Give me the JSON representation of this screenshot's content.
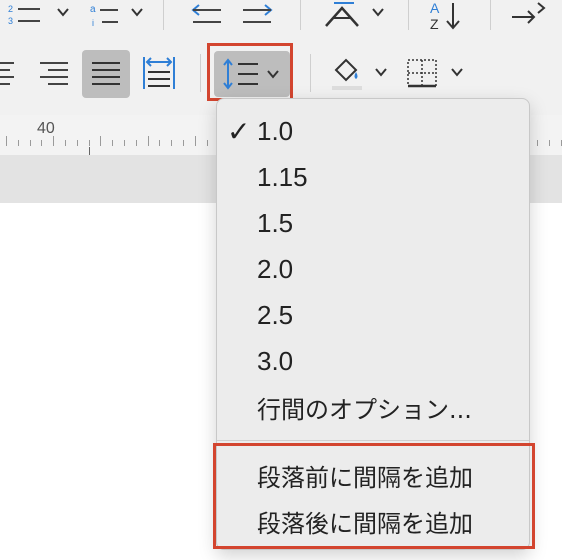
{
  "ruler": {
    "number": "40"
  },
  "line_spacing_menu": {
    "selected": "1.0",
    "items": [
      {
        "label": "1.0",
        "checked": true
      },
      {
        "label": "1.15",
        "checked": false
      },
      {
        "label": "1.5",
        "checked": false
      },
      {
        "label": "2.0",
        "checked": false
      },
      {
        "label": "2.5",
        "checked": false
      },
      {
        "label": "3.0",
        "checked": false
      },
      {
        "label": "行間のオプション...",
        "checked": false
      }
    ],
    "paragraph_items": [
      {
        "label": "段落前に間隔を追加"
      },
      {
        "label": "段落後に間隔を追加"
      }
    ]
  },
  "icons": {
    "checkmark": "✓",
    "chevron": "chevron-down-icon"
  },
  "colors": {
    "highlight": "#d3452f",
    "toolbar_bg": "#f1f1f1",
    "menu_bg": "#ececec",
    "icon_blue": "#2f7fd6",
    "active_button": "#bdbdbd"
  }
}
